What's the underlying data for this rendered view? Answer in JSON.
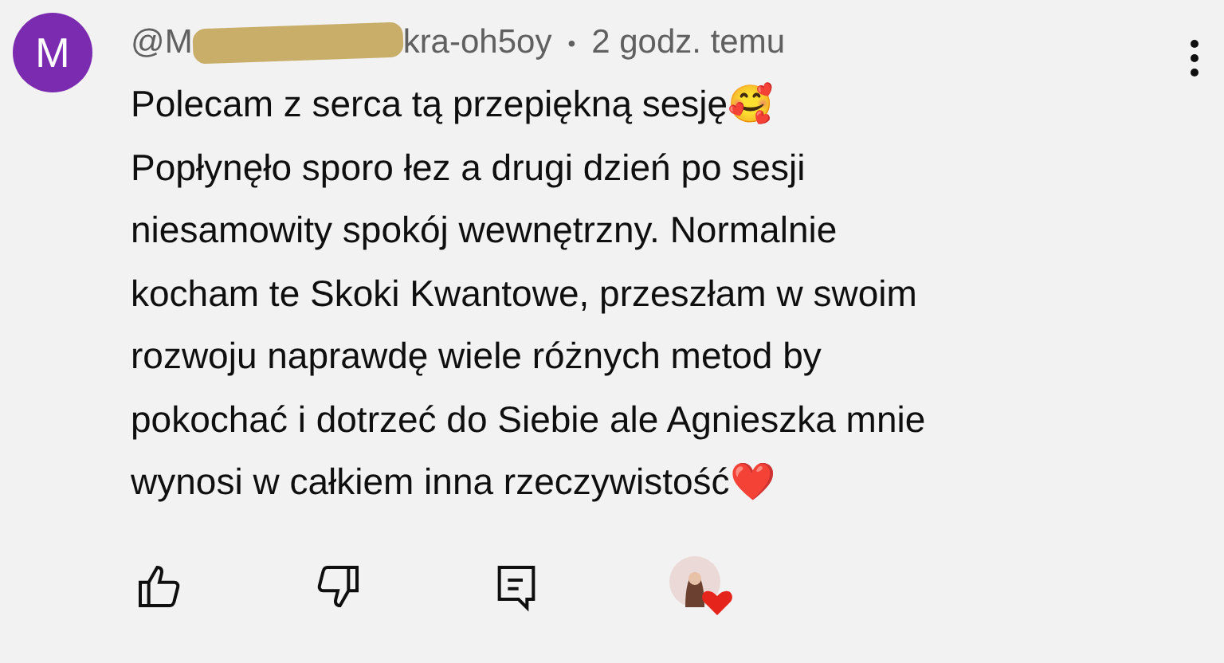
{
  "comment": {
    "avatar_letter": "M",
    "author_start": "@M",
    "author_hidden": true,
    "author_end": "kra-oh5oy",
    "separator": "•",
    "time": "2 godz. temu",
    "lines": [
      "Polecam z serca tą przepiękną sesję🥰",
      "Popłynęło sporo łez a drugi dzień po sesji",
      "niesamowity spokój wewnętrzny. Normalnie",
      "kocham te Skoki Kwantowe, przeszłam w swoim",
      "rozwoju naprawdę wiele różnych metod by",
      "pokochać i dotrzeć do Siebie ale Agnieszka mnie",
      "wynosi w całkiem inna rzeczywistość❤️"
    ],
    "hearted_by_creator": true
  }
}
